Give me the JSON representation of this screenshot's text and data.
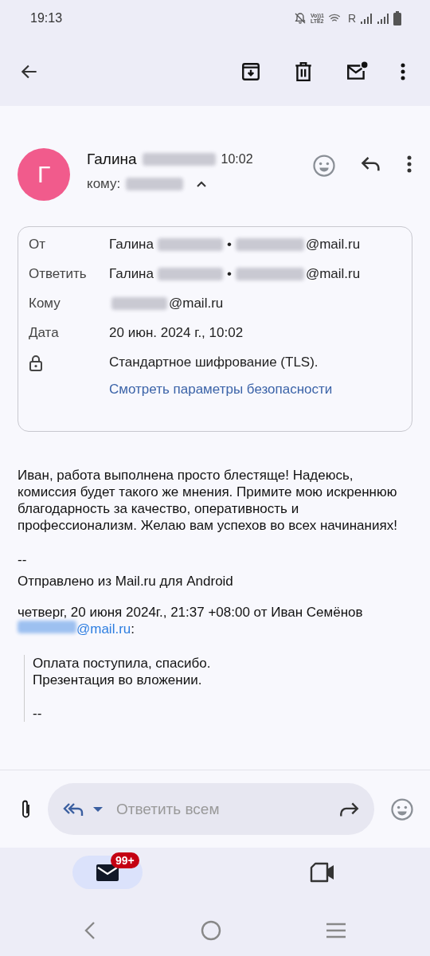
{
  "status_bar": {
    "time": "19:13",
    "volte_top": "Vo))1",
    "volte_bottom": "LTE2",
    "roaming": "R"
  },
  "message": {
    "avatar_initial": "Г",
    "sender": "Галина",
    "time": "10:02",
    "to_label": "кому:",
    "expanded": true,
    "details": [
      {
        "kind": "address",
        "label": "От",
        "name": "Галина",
        "separator": "•",
        "email": "@mail.ru"
      },
      {
        "kind": "address",
        "label": "Ответить",
        "name": "Галина",
        "separator": "•",
        "email": "@mail.ru"
      },
      {
        "kind": "email",
        "label": "Кому",
        "email": "@mail.ru"
      },
      {
        "kind": "text",
        "label": "Дата",
        "value": "20 июн. 2024 г., 10:02"
      },
      {
        "kind": "security",
        "value": "Стандартное шифрование (TLS).",
        "link": "Смотреть параметры безопасности"
      }
    ],
    "body": [
      "Иван, работа выполнена просто блестяще! Надеюсь, комиссия будет такого же мнения. Примите мою искреннюю благодарность за качество, оперативность и профессионализм. Желаю вам успехов во всех начинаниях!"
    ],
    "signature": [
      "--",
      "Отправлено из Mail.ru для Android"
    ],
    "quote_header": {
      "text": "четверг, 20 июня 2024г., 21:37 +08:00 от Иван Семёнов",
      "link": "@mail.ru",
      "after": ":"
    },
    "quote": [
      "Оплата поступила, спасибо.",
      "Презентация во вложении.",
      "--"
    ]
  },
  "reply_bar": {
    "placeholder": "Ответить всем"
  },
  "bottom_nav": [
    {
      "kind": "mail",
      "selected": true,
      "badge": "99+"
    },
    {
      "kind": "video",
      "selected": false
    }
  ]
}
